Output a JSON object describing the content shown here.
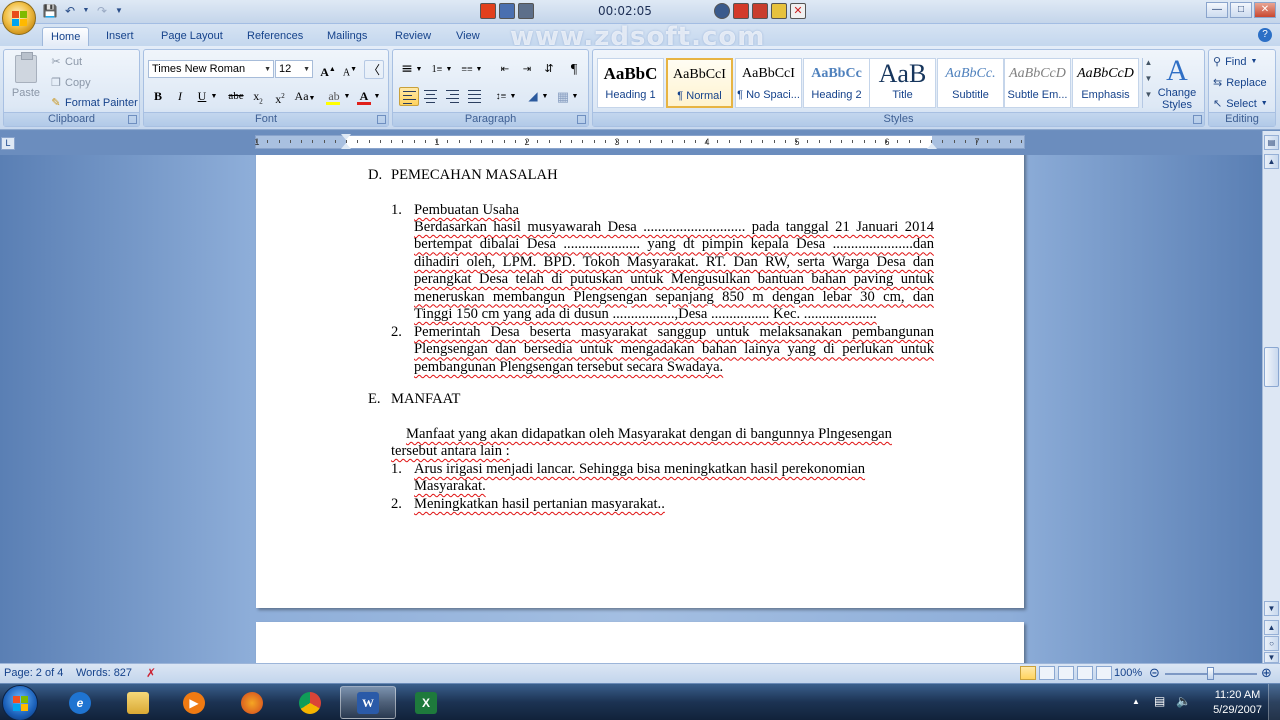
{
  "recorder": {
    "time": "00:02:05",
    "watermark": "www.zdsoft.com"
  },
  "tabs": [
    "Home",
    "Insert",
    "Page Layout",
    "References",
    "Mailings",
    "Review",
    "View"
  ],
  "clipboard": {
    "paste": "Paste",
    "cut": "Cut",
    "copy": "Copy",
    "format_painter": "Format Painter",
    "label": "Clipboard"
  },
  "font": {
    "name": "Times New Roman",
    "size": "12",
    "label": "Font"
  },
  "paragraph": {
    "label": "Paragraph"
  },
  "styles": {
    "label": "Styles",
    "items": [
      {
        "sample": "AaBbC",
        "name": "Heading 1"
      },
      {
        "sample": "AaBbCcI",
        "name": "¶ Normal"
      },
      {
        "sample": "AaBbCcI",
        "name": "¶ No Spaci..."
      },
      {
        "sample": "AaBbCc",
        "name": "Heading 2"
      },
      {
        "sample": "AaB",
        "name": "Title"
      },
      {
        "sample": "AaBbCc.",
        "name": "Subtitle"
      },
      {
        "sample": "AaBbCcD",
        "name": "Subtle Em..."
      },
      {
        "sample": "AaBbCcD",
        "name": "Emphasis"
      }
    ],
    "change_styles": "Change Styles"
  },
  "editing": {
    "find": "Find",
    "replace": "Replace",
    "select": "Select",
    "label": "Editing"
  },
  "ruler": {
    "numbers": [
      "1",
      "1",
      "2",
      "3",
      "4",
      "5",
      "6",
      "7"
    ]
  },
  "document": {
    "section_d": {
      "letter": "D.",
      "title": "PEMECAHAN MASALAH"
    },
    "item1_num": "1.",
    "item1_title": "Pembuatan Usaha",
    "item1_lines": [
      "Berdasarkan hasil musyawarah Desa ............................ pada tanggal 21 Januari 2014",
      "bertempat dibalai Desa ..................... yang dt pimpin kepala Desa ......................dan",
      "dihadiri oleh, LPM. BPD. Tokoh Masyarakat. RT. Dan RW, serta Warga Desa dan",
      "perangkat Desa telah di putuskan untuk Mengusulkan bantuan bahan paving untuk",
      "meneruskan membangun Plengsengan  sepanjang 850 m dengan lebar 30 cm, dan",
      "Tinggi 150 cm yang ada di dusun .................,Desa ................ Kec. ...................."
    ],
    "item2_num": "2.",
    "item2_lines": [
      "Pemerintah Desa beserta masyarakat sanggup untuk melaksanakan pembangunan",
      "Plengsengan dan bersedia untuk mengadakan bahan lainya yang di perlukan untuk",
      "pembangunan Plengsengan tersebut secara Swadaya."
    ],
    "section_e": {
      "letter": "E.",
      "title": "MANFAAT"
    },
    "manfaat_lines": [
      "Manfaat yang akan didapatkan oleh Masyarakat dengan di bangunnya Plngesengan",
      "tersebut antara lain :"
    ],
    "benefits": [
      {
        "num": "1.",
        "lines": [
          "Arus irigasi menjadi lancar. Sehingga bisa meningkatkan hasil perekonomian",
          "Masyarakat."
        ]
      },
      {
        "num": "2.",
        "lines": [
          "Meningkatkan hasil pertanian masyarakat.."
        ]
      }
    ]
  },
  "status": {
    "page": "Page: 2 of 4",
    "words": "Words: 827",
    "zoom": "100%"
  },
  "taskbar": {
    "time": "11:20 AM",
    "date": "5/29/2007"
  }
}
